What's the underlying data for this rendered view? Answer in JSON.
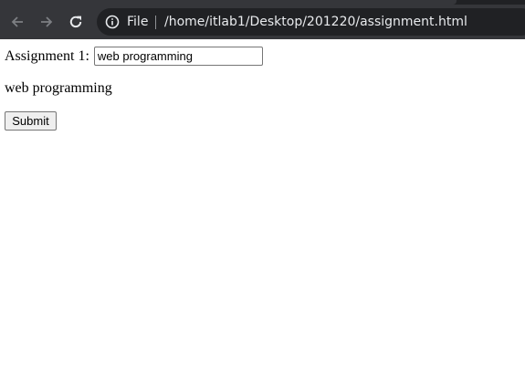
{
  "browser": {
    "site_info_chip": "File",
    "url": "/home/itlab1/Desktop/201220/assignment.html",
    "icons": {
      "back": "arrow-left-icon",
      "forward": "arrow-right-icon",
      "reload": "reload-icon",
      "site_info": "info-icon"
    }
  },
  "form": {
    "label": "Assignment 1:",
    "input_value": "web programming",
    "output_text": "web programming",
    "submit_label": "Submit"
  }
}
